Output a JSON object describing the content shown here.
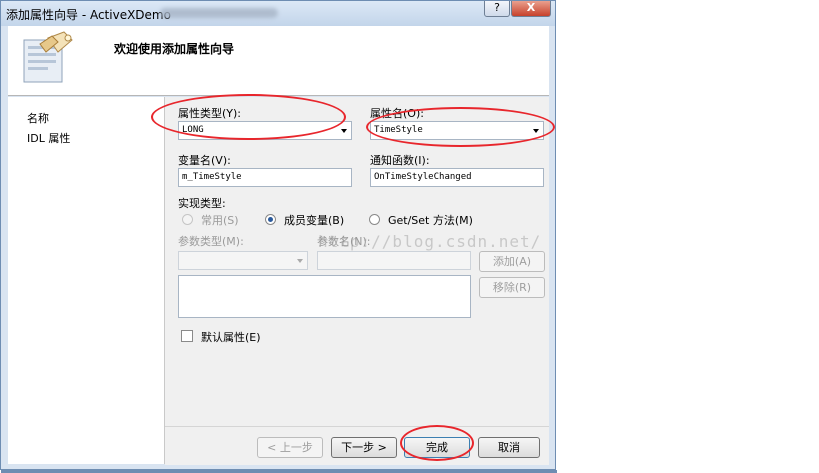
{
  "window": {
    "title": "添加属性向导 - ActiveXDemo",
    "help_label": "?",
    "close_label": "X"
  },
  "header": {
    "title": "欢迎使用添加属性向导"
  },
  "sidebar": {
    "items": [
      {
        "label": "名称"
      },
      {
        "label": "IDL 属性"
      }
    ]
  },
  "form": {
    "property_type": {
      "label": "属性类型(Y):",
      "value": "LONG"
    },
    "property_name": {
      "label": "属性名(O):",
      "value": "TimeStyle"
    },
    "variable_name": {
      "label": "变量名(V):",
      "value": "m_TimeStyle"
    },
    "notify_function": {
      "label": "通知函数(I):",
      "value": "OnTimeStyleChanged"
    },
    "impl_type": {
      "label": "实现类型:",
      "options": [
        {
          "label": "常用(S)",
          "selected": false,
          "enabled": false
        },
        {
          "label": "成员变量(B)",
          "selected": true,
          "enabled": true
        },
        {
          "label": "Get/Set 方法(M)",
          "selected": false,
          "enabled": true
        }
      ]
    },
    "param_type": {
      "label": "参数类型(M):",
      "value": ""
    },
    "param_name": {
      "label": "参数名(N):",
      "value": ""
    },
    "add_label": "添加(A)",
    "remove_label": "移除(R)",
    "default_property": {
      "label": "默认属性(E)",
      "checked": false
    }
  },
  "footer": {
    "back_label": "< 上一步",
    "next_label": "下一步 >",
    "finish_label": "完成",
    "cancel_label": "取消"
  },
  "watermark": "http://blog.csdn.net/",
  "colors": {
    "annotation": "#e8262c",
    "dialog_border": "#6e8db2"
  }
}
